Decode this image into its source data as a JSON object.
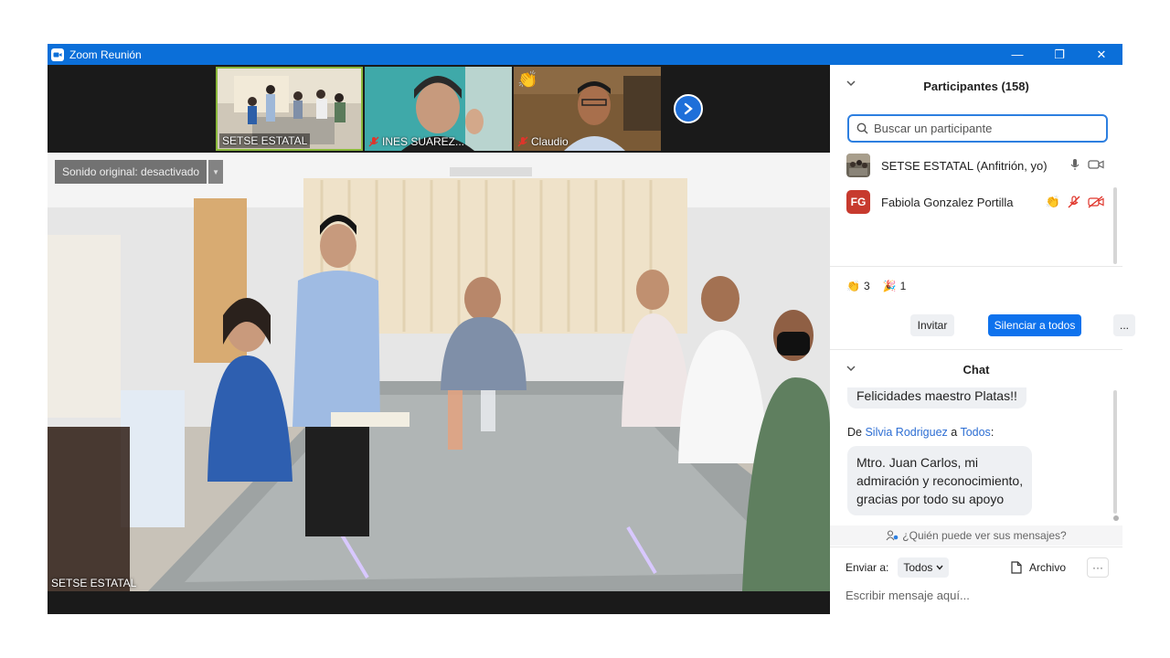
{
  "window": {
    "title": "Zoom Reunión",
    "minimize": "—",
    "restore": "❐",
    "close": "✕"
  },
  "thumbnails": [
    {
      "name": "SETSE ESTATAL",
      "muted": false,
      "active": true
    },
    {
      "name": "INES SUAREZ...",
      "muted": true,
      "active": false
    },
    {
      "name": "Claudio",
      "muted": true,
      "active": false,
      "reaction": "👏"
    }
  ],
  "main_video": {
    "audio_pill": "Sonido original: desactivado",
    "label": "SETSE ESTATAL"
  },
  "participants": {
    "header": "Participantes (158)",
    "search_placeholder": "Buscar un participante",
    "list": [
      {
        "name": "SETSE ESTATAL (Anfitrión, yo)",
        "avatar": "photo",
        "icons": [
          "mic-icon",
          "video-icon"
        ]
      },
      {
        "name": "Fabiola Gonzalez Portilla",
        "avatar": "FG",
        "icons": [
          "clap-icon",
          "mic-muted-icon",
          "video-off-icon"
        ]
      }
    ],
    "reactions": [
      {
        "emoji": "👏",
        "count": "3"
      },
      {
        "emoji": "🎉",
        "count": "1"
      }
    ],
    "buttons": {
      "invite": "Invitar",
      "mute_all": "Silenciar a todos",
      "more": "..."
    }
  },
  "chat": {
    "header": "Chat",
    "messages": [
      {
        "text": "Felicidades maestro Platas!!"
      },
      {
        "from_prefix": "De ",
        "from": "Silvia Rodriguez",
        "to_prefix": " a ",
        "to": "Todos",
        "suffix": ":",
        "lines": [
          "Mtro. Juan Carlos, mi",
          "admiración y reconocimiento,",
          "gracias por todo su apoyo"
        ]
      }
    ],
    "who_can_see": "¿Quién puede ver sus mensajes?",
    "send_to_label": "Enviar a:",
    "send_to_value": "Todos",
    "file_label": "Archivo",
    "more": "···",
    "input_placeholder": "Escribir mensaje aquí..."
  },
  "colors": {
    "titlebar": "#0b6fd9",
    "accent": "#0e72ed",
    "muted_red": "#e0352b",
    "active_thumb": "#8ab83a"
  }
}
